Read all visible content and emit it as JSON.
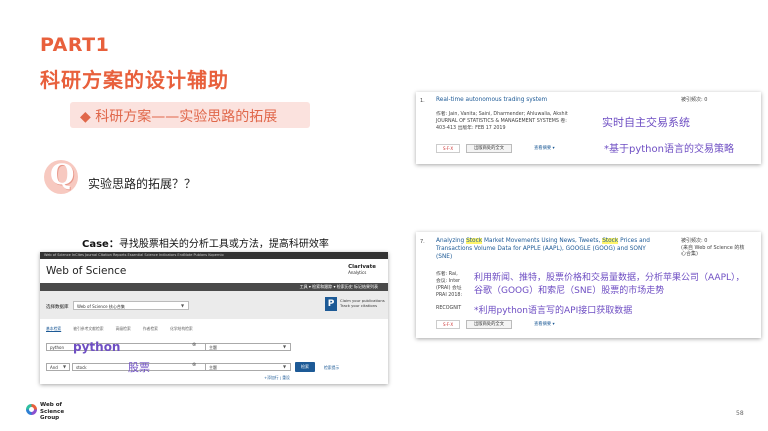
{
  "slide": {
    "part": "PART1",
    "title": "科研方案的设计辅助",
    "subtitle": "◆ 科研方案——实验思路的拓展",
    "q_letter": "Q",
    "question": "实验思路的拓展？？",
    "case_label": "Case：",
    "case_text": "寻找股票相关的分析工具或方法，提高科研效率",
    "page_number": "58",
    "logo_lines": [
      "Web of",
      "Science",
      "Group"
    ]
  },
  "wos_panel": {
    "top_links": "Web of Science   InCites   Journal Citation Reports   Essential Science Indicators   EndNote   Publons   Kopernio",
    "brand": "Web of Science",
    "clarivate": "Clarivate",
    "clarivate_sub": "Analytics",
    "nav": "工具 ▾   检索和跟踪 ▾   检索历史   标记结果列表",
    "db_label": "选择数据库",
    "db_value": "Web of Science 核心合集",
    "claim_line1": "Claim your publications",
    "claim_line2": "Track your citations",
    "tabs": [
      "基本检索",
      "被引参考文献检索",
      "高级检索",
      "作者检索",
      "化学结构检索"
    ],
    "row1_value": "python",
    "row1_field": "主题",
    "row2_op": "And",
    "row2_value": "stock",
    "row2_field": "主题",
    "search_button": "检索",
    "search_tip": "检索提示",
    "add_row": "+添加行 | 重设",
    "anno_python": "python",
    "anno_stock": "股票"
  },
  "result1": {
    "number": "1.",
    "title": "Real-time autonomous trading system",
    "cited_label": "被引频次: 0",
    "authors": "作者: Jain, Vanita; Saini, Dharmender; Ahluwalia, Akshit",
    "journal": "JOURNAL OF STATISTICS & MANAGEMENT SYSTEMS  卷:",
    "pages": "403-413  出版年: FEB 17 2019",
    "sfx": "S·F·X",
    "fulltext": "出版商处的全文",
    "abstract": "查看摘要 ▾",
    "anno1": "实时自主交易系统",
    "anno2": "*基于python语言的交易策略"
  },
  "result2": {
    "number": "7.",
    "title_pre": "Analyzing ",
    "title_hl1": "Stock",
    "title_mid": " Market Movements Using News, Tweets, ",
    "title_hl2": "Stock",
    "title_post": " Prices and",
    "title_line2": "Transactions Volume Data for APPLE (AAPL), GOOGLE (GOOG) and SONY",
    "title_line3": "(SNE)",
    "cited_label": "被引频次: 0",
    "cited_sub1": "(来自 Web of Science 的核",
    "cited_sub2": "心合集)",
    "meta_line1": "作者: Rai,",
    "meta_line2": "会议: Inter",
    "meta_line3": "(PRAI) 会址",
    "meta_line4": "PRAI 2018:",
    "meta_line5": "RECOGNIT",
    "sfx": "S·F·X",
    "fulltext": "出版商处的全文",
    "abstract": "查看摘要 ▾",
    "anno1": "利用新闻、推特，股票价格和交易量数据，分析苹果公司（AAPL），",
    "anno2": "谷歌（GOOG）和索尼（SNE）股票的市场走势",
    "anno3": "*利用python语言写的API接口获取数据"
  },
  "colors": {
    "accent": "#e8603c",
    "annotation": "#6e4ec3",
    "link": "#1d5a96",
    "highlight": "#fff56a"
  }
}
